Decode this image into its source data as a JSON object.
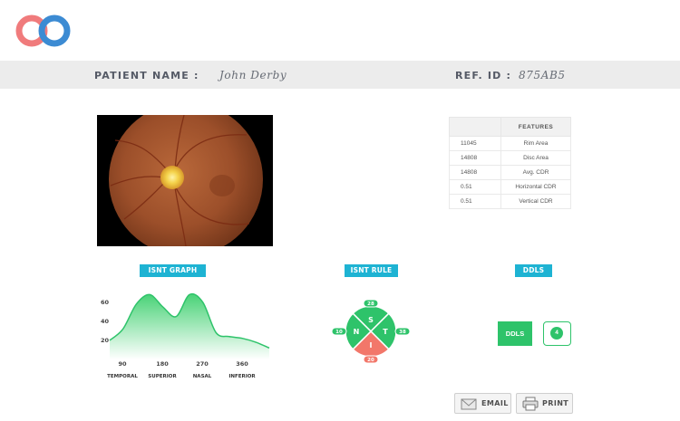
{
  "header": {
    "patient_label": "PATIENT NAME :",
    "patient_name": "John Derby",
    "ref_label": "REF. ID :",
    "ref_id": "875AB5"
  },
  "colors": {
    "logo_left": "#f07b7c",
    "logo_right": "#3c8bd3",
    "accent_tag": "#1eb3d3",
    "green": "#2ec36a",
    "red": "#f2776a"
  },
  "features_table": {
    "header": "FEATURES",
    "rows": [
      {
        "value": "11045",
        "name": "Rim Area"
      },
      {
        "value": "14808",
        "name": "Disc Area"
      },
      {
        "value": "14808",
        "name": "Avg. CDR"
      },
      {
        "value": "0.51",
        "name": "Horizontal CDR"
      },
      {
        "value": "0.51",
        "name": "Vertical CDR"
      }
    ]
  },
  "sections": {
    "isnt_graph": "ISNT GRAPH",
    "isnt_rule": "ISNT RULE",
    "ddls": "DDLS"
  },
  "chart_data": {
    "type": "area",
    "x": [
      0,
      30,
      60,
      90,
      120,
      150,
      180,
      210,
      240,
      270,
      300,
      330,
      360
    ],
    "values": [
      20,
      32,
      58,
      68,
      55,
      45,
      68,
      60,
      28,
      24,
      22,
      18,
      12
    ],
    "xticks": [
      "90",
      "180",
      "270",
      "360"
    ],
    "xtick_values": [
      90,
      180,
      270,
      360
    ],
    "xcategories": [
      "TEMPORAL",
      "SUPERIOR",
      "NASAL",
      "INFERIOR"
    ],
    "yticks": [
      "20",
      "40",
      "60"
    ],
    "ytick_values": [
      20,
      40,
      60
    ],
    "xlim": [
      0,
      360
    ],
    "ylim": [
      0,
      75
    ],
    "grid": false,
    "title": "",
    "xlabel": "",
    "ylabel": ""
  },
  "isnt_rule": {
    "quadrants": [
      {
        "key": "S",
        "label": "S",
        "value": "28",
        "color": "#2ec36a"
      },
      {
        "key": "T",
        "label": "T",
        "value": "38",
        "color": "#2ec36a"
      },
      {
        "key": "I",
        "label": "I",
        "value": "20",
        "color": "#f2776a"
      },
      {
        "key": "N",
        "label": "N",
        "value": "10",
        "color": "#2ec36a"
      }
    ]
  },
  "ddls": {
    "button_label": "DDLS",
    "score": "4"
  },
  "actions": {
    "email_label": "EMAIL",
    "print_label": "PRINT"
  }
}
